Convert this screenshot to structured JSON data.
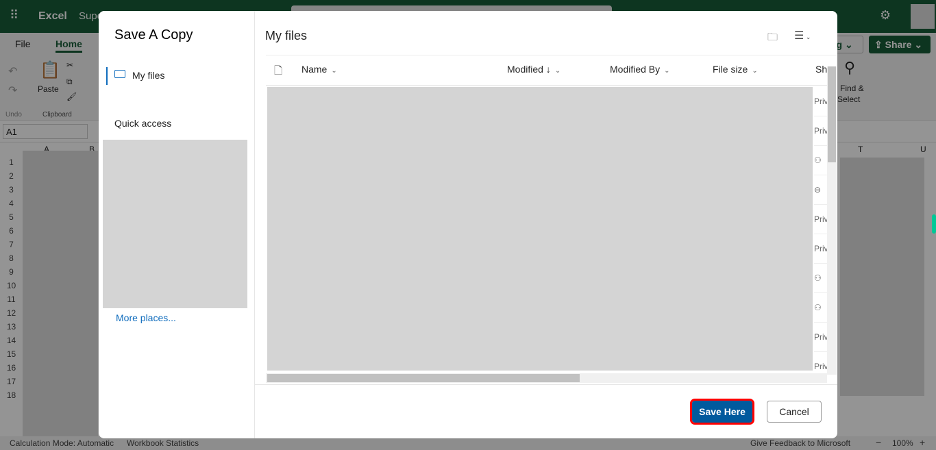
{
  "excel": {
    "app_name": "Excel",
    "doc_name": "Supe",
    "tabs": [
      "File",
      "Home"
    ],
    "ribbon": {
      "undo_group": "Undo",
      "paste": "Paste",
      "clipboard_group": "Clipboard",
      "find_select_line1": "Find &",
      "find_select_line2": "Select",
      "editing_fragment": "ng",
      "share": "Share"
    },
    "name_box": "A1",
    "columns": [
      "A",
      "B",
      "T",
      "U"
    ],
    "rows": [
      "1",
      "2",
      "3",
      "4",
      "5",
      "6",
      "7",
      "8",
      "9",
      "10",
      "11",
      "12",
      "13",
      "14",
      "15",
      "16",
      "17",
      "18"
    ],
    "status": {
      "calc_mode": "Calculation Mode: Automatic",
      "workbook_stats": "Workbook Statistics",
      "feedback": "Give Feedback to Microsoft",
      "zoom": "100%",
      "zoom_out": "−",
      "zoom_in": "+"
    }
  },
  "dialog": {
    "title": "Save A Copy",
    "nav": {
      "my_files": "My files",
      "quick_access": "Quick access",
      "more_places": "More places..."
    },
    "main_title": "My files",
    "columns": {
      "name": "Name",
      "modified": "Modified ↓",
      "modified_by": "Modified By",
      "file_size": "File size",
      "sharing": "Sh"
    },
    "sharing_rows": [
      "Priv",
      "Priv",
      "people-icon",
      "link-icon",
      "Priv",
      "Priv",
      "people-icon",
      "people-icon",
      "Priv",
      "Priv"
    ],
    "save_button": "Save Here",
    "cancel_button": "Cancel",
    "colors": {
      "accent": "#0f6cbd",
      "save_bg": "#005a9e",
      "highlight": "#ff0000"
    }
  }
}
